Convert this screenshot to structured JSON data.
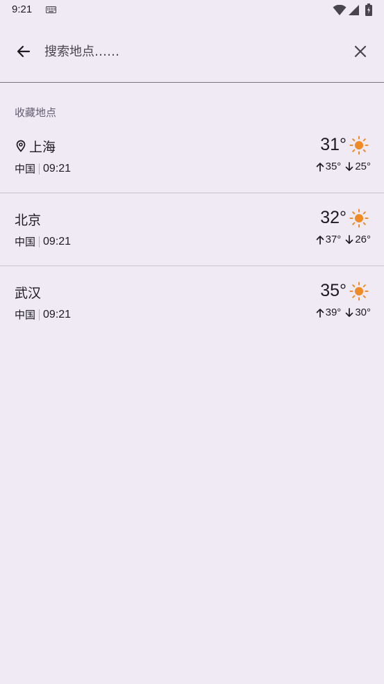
{
  "status_bar": {
    "time": "9:21",
    "icons": [
      "keyboard-icon",
      "wifi-icon",
      "signal-icon",
      "battery-icon"
    ]
  },
  "search": {
    "placeholder": "搜索地点……",
    "value": "",
    "back_icon": "arrow-left-icon",
    "clear_icon": "close-icon"
  },
  "favorites": {
    "section_label": "收藏地点",
    "items": [
      {
        "name": "上海",
        "current_location": true,
        "country": "中国",
        "time": "09:21",
        "temp": "31°",
        "high": "35°",
        "low": "25°",
        "condition_icon": "sun-icon"
      },
      {
        "name": "北京",
        "current_location": false,
        "country": "中国",
        "time": "09:21",
        "temp": "32°",
        "high": "37°",
        "low": "26°",
        "condition_icon": "sun-icon"
      },
      {
        "name": "武汉",
        "current_location": false,
        "country": "中国",
        "time": "09:21",
        "temp": "35°",
        "high": "39°",
        "low": "30°",
        "condition_icon": "sun-icon"
      }
    ]
  },
  "colors": {
    "background": "#efeaf4",
    "sun": "#f08a24",
    "text": "#1d1b20",
    "secondary_text": "#625b71"
  }
}
